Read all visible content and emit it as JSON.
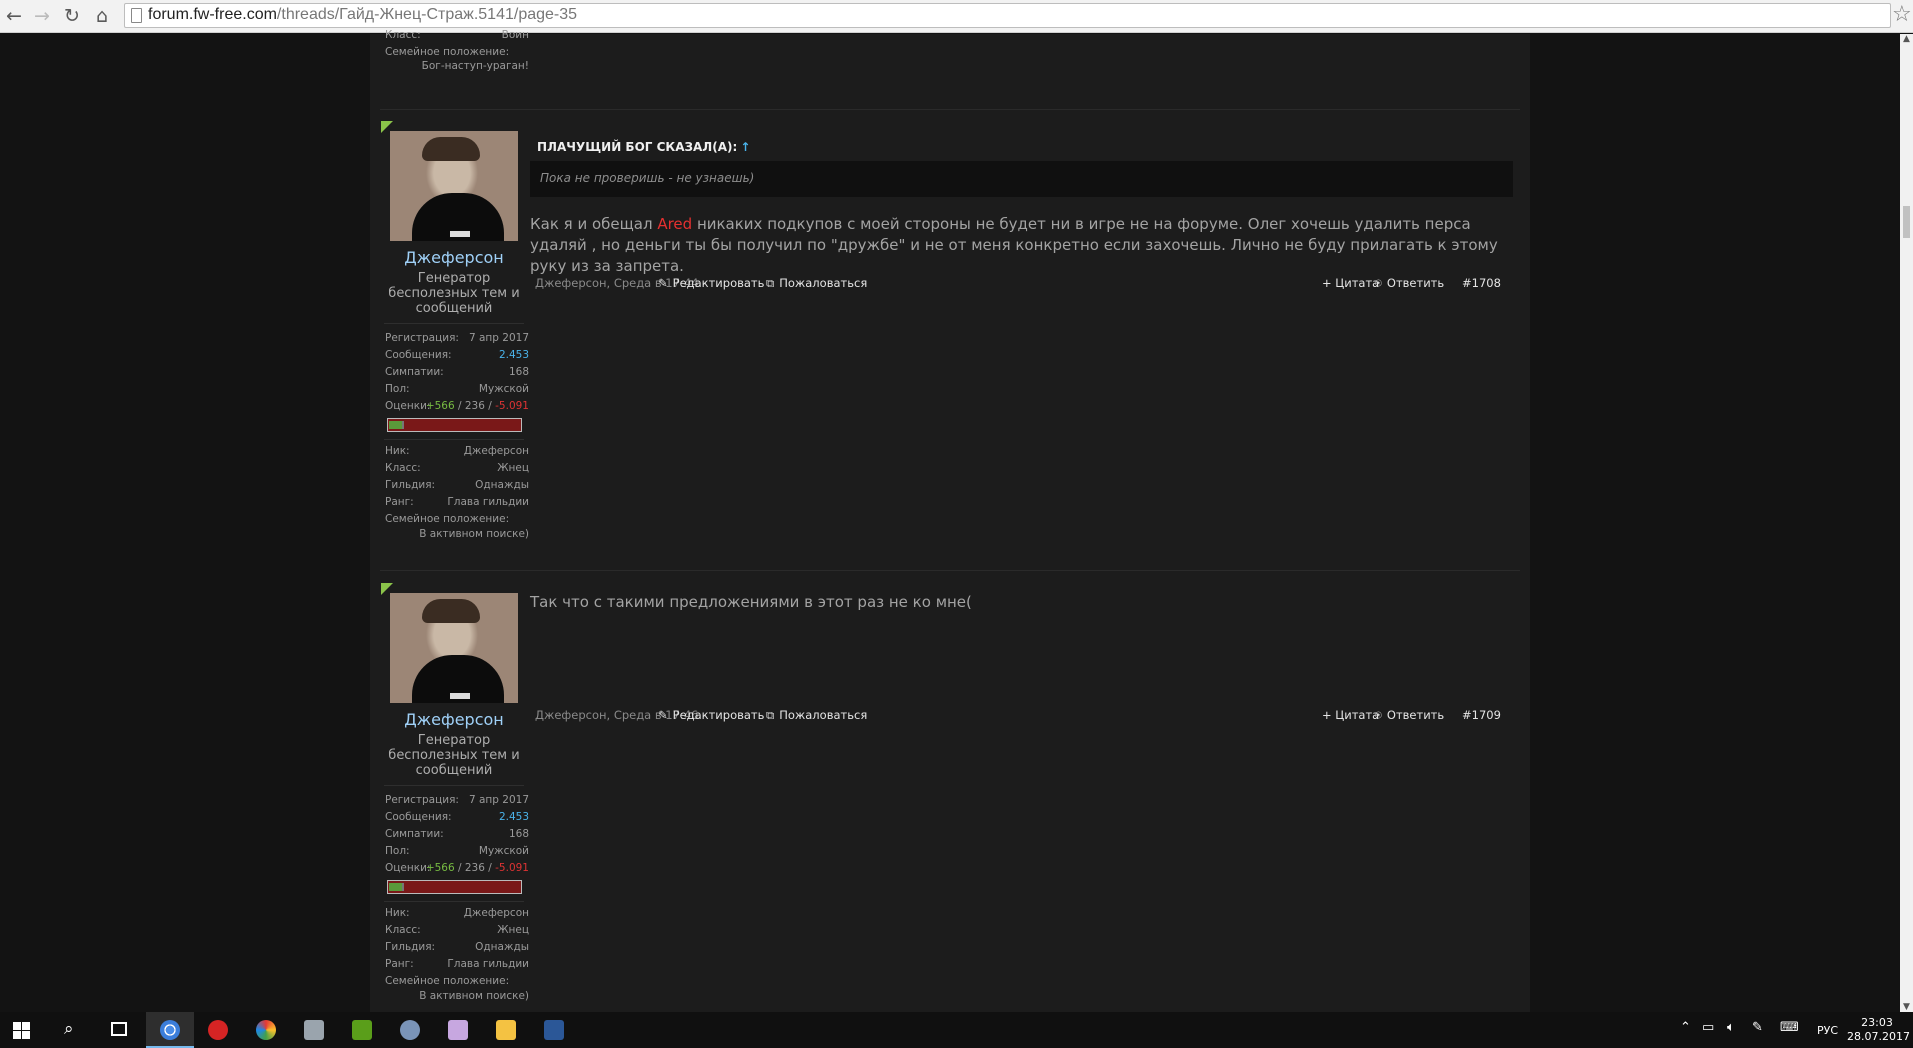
{
  "browser": {
    "url_host": "forum.fw-free.com",
    "url_path": "/threads/Гайд-Жнец-Страж.5141/page-35"
  },
  "prev_post_tail": {
    "class_label": "Класс:",
    "class_value": "Воин",
    "family_label": "Семейное положение:",
    "family_value": "Бог-наступ-ураган!"
  },
  "posts": [
    {
      "author": "Джеферсон",
      "user_title": "Генератор бесполезных тем и сообщений",
      "stats": {
        "reg_label": "Регистрация:",
        "reg_value": "7 апр 2017",
        "msgs_label": "Сообщения:",
        "msgs_value": "2.453",
        "likes_label": "Симпатии:",
        "likes_value": "168",
        "gender_label": "Пол:",
        "gender_value": "Мужской",
        "ratings_label": "Оценки:",
        "ratings_pos": "+566",
        "ratings_mid": "236",
        "ratings_neg": "-5.091",
        "rating_fraction": 0.1,
        "nick_label": "Ник:",
        "nick_value": "Джеферсон",
        "class_label": "Класс:",
        "class_value": "Жнец",
        "guild_label": "Гильдия:",
        "guild_value": "Однажды",
        "rank_label": "Ранг:",
        "rank_value": "Глава гильдии",
        "family_label": "Семейное положение:",
        "family_value": "В активном поиске)"
      },
      "quote_author": "ПЛАЧУЩИЙ БОГ СКАЗАЛ(А):",
      "quote_arrow": "↑",
      "quote_text": "Пока не проверишь - не узнаешь)",
      "body_before": "Как я и обещал ",
      "body_mention": "Ared",
      "body_after": " никаких подкупов с моей стороны не будет ни в игре не на форуме. Олег хочешь удалить перса удаляй , но деньги ты бы получил по \"дружбе\" и не от меня конкретно если захочешь. Лично не буду прилагать к этому руку из за запрета.",
      "date": "Джеферсон, Среда в 17:44",
      "edit": "Редактировать",
      "report": "Пожаловаться",
      "quote_btn": "+ Цитата",
      "reply": "Ответить",
      "num": "#1708"
    },
    {
      "author": "Джеферсон",
      "user_title": "Генератор бесполезных тем и сообщений",
      "stats": {
        "reg_label": "Регистрация:",
        "reg_value": "7 апр 2017",
        "msgs_label": "Сообщения:",
        "msgs_value": "2.453",
        "likes_label": "Симпатии:",
        "likes_value": "168",
        "gender_label": "Пол:",
        "gender_value": "Мужской",
        "ratings_label": "Оценки:",
        "ratings_pos": "+566",
        "ratings_mid": "236",
        "ratings_neg": "-5.091",
        "rating_fraction": 0.1,
        "nick_label": "Ник:",
        "nick_value": "Джеферсон",
        "class_label": "Класс:",
        "class_value": "Жнец",
        "guild_label": "Гильдия:",
        "guild_value": "Однажды",
        "rank_label": "Ранг:",
        "rank_value": "Глава гильдии",
        "family_label": "Семейное положение:",
        "family_value": "В активном поиске)"
      },
      "body": "Так что с такими предложениями в этот раз не ко мне(",
      "date": "Джеферсон, Среда в 17:46",
      "edit": "Редактировать",
      "report": "Пожаловаться",
      "quote_btn": "+ Цитата",
      "reply": "Ответить",
      "num": "#1709"
    }
  ],
  "taskbar": {
    "lang": "РУС",
    "time": "23:03",
    "date": "28.07.2017"
  }
}
